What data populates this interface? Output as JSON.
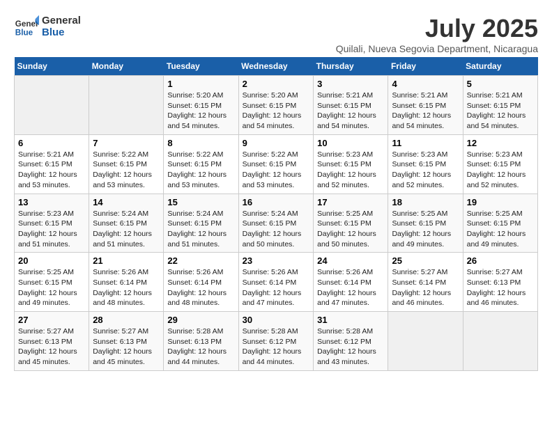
{
  "header": {
    "logo_line1": "General",
    "logo_line2": "Blue",
    "month": "July 2025",
    "location": "Quilali, Nueva Segovia Department, Nicaragua"
  },
  "weekdays": [
    "Sunday",
    "Monday",
    "Tuesday",
    "Wednesday",
    "Thursday",
    "Friday",
    "Saturday"
  ],
  "weeks": [
    [
      {
        "day": "",
        "empty": true
      },
      {
        "day": "",
        "empty": true
      },
      {
        "day": "1",
        "sunrise": "5:20 AM",
        "sunset": "6:15 PM",
        "daylight": "12 hours and 54 minutes."
      },
      {
        "day": "2",
        "sunrise": "5:20 AM",
        "sunset": "6:15 PM",
        "daylight": "12 hours and 54 minutes."
      },
      {
        "day": "3",
        "sunrise": "5:21 AM",
        "sunset": "6:15 PM",
        "daylight": "12 hours and 54 minutes."
      },
      {
        "day": "4",
        "sunrise": "5:21 AM",
        "sunset": "6:15 PM",
        "daylight": "12 hours and 54 minutes."
      },
      {
        "day": "5",
        "sunrise": "5:21 AM",
        "sunset": "6:15 PM",
        "daylight": "12 hours and 54 minutes."
      }
    ],
    [
      {
        "day": "6",
        "sunrise": "5:21 AM",
        "sunset": "6:15 PM",
        "daylight": "12 hours and 53 minutes."
      },
      {
        "day": "7",
        "sunrise": "5:22 AM",
        "sunset": "6:15 PM",
        "daylight": "12 hours and 53 minutes."
      },
      {
        "day": "8",
        "sunrise": "5:22 AM",
        "sunset": "6:15 PM",
        "daylight": "12 hours and 53 minutes."
      },
      {
        "day": "9",
        "sunrise": "5:22 AM",
        "sunset": "6:15 PM",
        "daylight": "12 hours and 53 minutes."
      },
      {
        "day": "10",
        "sunrise": "5:23 AM",
        "sunset": "6:15 PM",
        "daylight": "12 hours and 52 minutes."
      },
      {
        "day": "11",
        "sunrise": "5:23 AM",
        "sunset": "6:15 PM",
        "daylight": "12 hours and 52 minutes."
      },
      {
        "day": "12",
        "sunrise": "5:23 AM",
        "sunset": "6:15 PM",
        "daylight": "12 hours and 52 minutes."
      }
    ],
    [
      {
        "day": "13",
        "sunrise": "5:23 AM",
        "sunset": "6:15 PM",
        "daylight": "12 hours and 51 minutes."
      },
      {
        "day": "14",
        "sunrise": "5:24 AM",
        "sunset": "6:15 PM",
        "daylight": "12 hours and 51 minutes."
      },
      {
        "day": "15",
        "sunrise": "5:24 AM",
        "sunset": "6:15 PM",
        "daylight": "12 hours and 51 minutes."
      },
      {
        "day": "16",
        "sunrise": "5:24 AM",
        "sunset": "6:15 PM",
        "daylight": "12 hours and 50 minutes."
      },
      {
        "day": "17",
        "sunrise": "5:25 AM",
        "sunset": "6:15 PM",
        "daylight": "12 hours and 50 minutes."
      },
      {
        "day": "18",
        "sunrise": "5:25 AM",
        "sunset": "6:15 PM",
        "daylight": "12 hours and 49 minutes."
      },
      {
        "day": "19",
        "sunrise": "5:25 AM",
        "sunset": "6:15 PM",
        "daylight": "12 hours and 49 minutes."
      }
    ],
    [
      {
        "day": "20",
        "sunrise": "5:25 AM",
        "sunset": "6:15 PM",
        "daylight": "12 hours and 49 minutes."
      },
      {
        "day": "21",
        "sunrise": "5:26 AM",
        "sunset": "6:14 PM",
        "daylight": "12 hours and 48 minutes."
      },
      {
        "day": "22",
        "sunrise": "5:26 AM",
        "sunset": "6:14 PM",
        "daylight": "12 hours and 48 minutes."
      },
      {
        "day": "23",
        "sunrise": "5:26 AM",
        "sunset": "6:14 PM",
        "daylight": "12 hours and 47 minutes."
      },
      {
        "day": "24",
        "sunrise": "5:26 AM",
        "sunset": "6:14 PM",
        "daylight": "12 hours and 47 minutes."
      },
      {
        "day": "25",
        "sunrise": "5:27 AM",
        "sunset": "6:14 PM",
        "daylight": "12 hours and 46 minutes."
      },
      {
        "day": "26",
        "sunrise": "5:27 AM",
        "sunset": "6:13 PM",
        "daylight": "12 hours and 46 minutes."
      }
    ],
    [
      {
        "day": "27",
        "sunrise": "5:27 AM",
        "sunset": "6:13 PM",
        "daylight": "12 hours and 45 minutes."
      },
      {
        "day": "28",
        "sunrise": "5:27 AM",
        "sunset": "6:13 PM",
        "daylight": "12 hours and 45 minutes."
      },
      {
        "day": "29",
        "sunrise": "5:28 AM",
        "sunset": "6:13 PM",
        "daylight": "12 hours and 44 minutes."
      },
      {
        "day": "30",
        "sunrise": "5:28 AM",
        "sunset": "6:12 PM",
        "daylight": "12 hours and 44 minutes."
      },
      {
        "day": "31",
        "sunrise": "5:28 AM",
        "sunset": "6:12 PM",
        "daylight": "12 hours and 43 minutes."
      },
      {
        "day": "",
        "empty": true
      },
      {
        "day": "",
        "empty": true
      }
    ]
  ],
  "labels": {
    "sunrise": "Sunrise:",
    "sunset": "Sunset:",
    "daylight": "Daylight:"
  }
}
